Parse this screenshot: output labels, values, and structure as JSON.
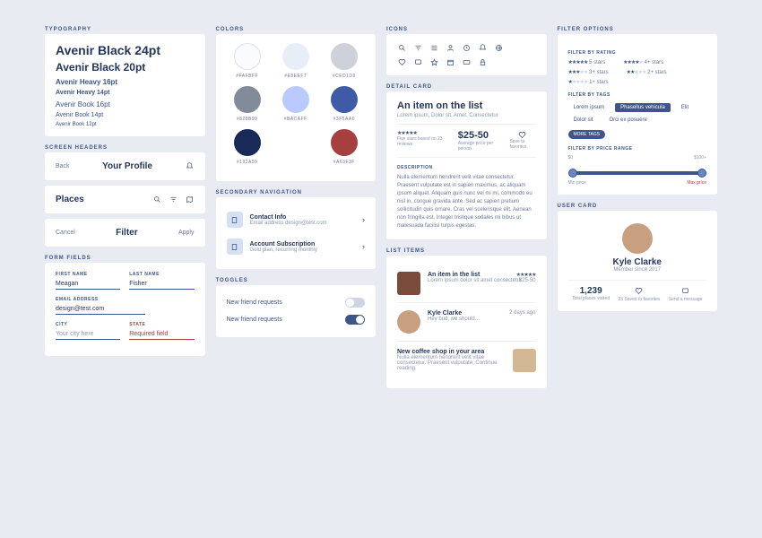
{
  "typography": {
    "title": "TYPOGRAPHY",
    "t1": "Avenir Black 24pt",
    "t2": "Avenir Black 20pt",
    "t3": "Avenir Heavy 16pt",
    "t4": "Avenir Heavy 14pt",
    "t5": "Avenir Book 16pt",
    "t6": "Avenir Book 14pt",
    "t7": "Avenir Book 12pt"
  },
  "screen_headers": {
    "title": "SCREEN HEADERS",
    "h1": {
      "left": "Back",
      "center": "Your Profile"
    },
    "h2": {
      "center": "Places"
    },
    "h3": {
      "left": "Cancel",
      "center": "Filter",
      "right": "Apply"
    }
  },
  "form": {
    "title": "FORM FIELDS",
    "first": {
      "label": "FIRST NAME",
      "value": "Meagan"
    },
    "last": {
      "label": "LAST NAME",
      "value": "Fisher"
    },
    "email": {
      "label": "EMAIL ADDRESS",
      "value": "design@test.com"
    },
    "city": {
      "label": "CITY",
      "value": "Your city here"
    },
    "state": {
      "label": "STATE",
      "value": "Required field"
    }
  },
  "colors": {
    "title": "COLORS",
    "list": [
      {
        "hex": "#FAFBFF"
      },
      {
        "hex": "#E8EEF7"
      },
      {
        "hex": "#CED1D9"
      },
      {
        "hex": "#828B99"
      },
      {
        "hex": "#BACAFF"
      },
      {
        "hex": "#3F5AA6"
      },
      {
        "hex": "#192A59"
      },
      {
        "hex": "#A63F3F"
      }
    ]
  },
  "secnav": {
    "title": "SECONDARY NAVIGATION",
    "items": [
      {
        "t": "Contact Info",
        "s": "Email address design@test.com"
      },
      {
        "t": "Account Subscription",
        "s": "Gold plan, recurring monthly"
      }
    ]
  },
  "toggles": {
    "title": "TOGGLES",
    "label": "New friend requests"
  },
  "icons": {
    "title": "ICONS"
  },
  "detail": {
    "title": "DETAIL CARD",
    "heading": "An item on the list",
    "sub": "Lorem ipsum, Dolor sit, Amet, Consectetur",
    "reviews": "Five stars based on 23 reviews",
    "price": "$25-50",
    "price_sub": "Average price per person",
    "save": "Save to favorites",
    "desc_title": "DESCRIPTION",
    "desc": "Nulla elementum hendrerit velit vitae consectetur. Praesent vulputate est in sapien maximus, ac aliquam ipsum aliquet. Aliquam quis nunc vel mi mi, commodo eu nisl in, congue gravida ante. Sed ac sapien pretium sollicitudin quis ornare. Cras vel scelerisque elit. Aenean non fringilla est. Integer tristique sodales mi bibus ut malesuada facilisi turpis egestas."
  },
  "list": {
    "title": "LIST ITEMS",
    "items": [
      {
        "t": "An item in the list",
        "s": "Lorem ipsum dolor sit amet consectetur",
        "price": "$25-50"
      },
      {
        "t": "Kyle Clarke",
        "s": "Hey bud, we should…",
        "time": "2 days ago"
      },
      {
        "t": "New coffee shop in your area",
        "s": "Nulla elementum hendrerit velit vitae consectetur. Praesent vulputate. Continue reading."
      }
    ]
  },
  "filter": {
    "title": "FILTER OPTIONS",
    "rating": {
      "title": "FILTER BY RATING",
      "opts": [
        "5 stars",
        "4+ stars",
        "3+ stars",
        "2+ stars",
        "1+ stars"
      ]
    },
    "tags": {
      "title": "FILTER BY TAGS",
      "t": [
        "Lorem ipsum",
        "Phasellus vehicula",
        "Elit",
        "Dolor sit",
        "Orci ex posuere"
      ],
      "more": "MORE TAGS"
    },
    "price": {
      "title": "FILTER BY PRICE RANGE",
      "min": "$0",
      "max": "$100+",
      "lmin": "Min price",
      "lmax": "Max price"
    }
  },
  "user": {
    "title": "USER CARD",
    "name": "Kyle Clarke",
    "since": "Member since 2017",
    "places": {
      "n": "1,239",
      "l": "Total places visited"
    },
    "saved": {
      "n": "23",
      "l": "Saved to favorites"
    },
    "msg": "Send a message"
  }
}
